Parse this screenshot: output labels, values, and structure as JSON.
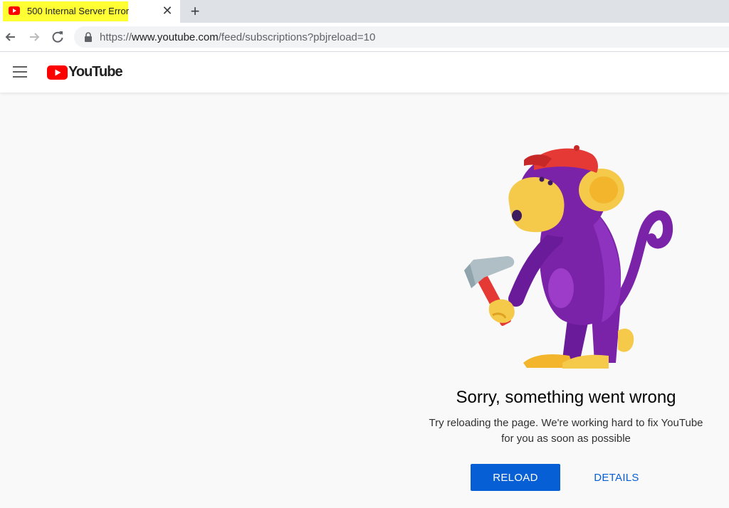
{
  "browser": {
    "tab": {
      "title": "500 Internal Server Error",
      "favicon": "youtube-icon",
      "highlight_color": "#ffff33"
    },
    "url": {
      "scheme": "https://",
      "host": "www.youtube.com",
      "path": "/feed/subscriptions?pbjreload=10"
    }
  },
  "masthead": {
    "logo_text": "YouTube",
    "brand_color": "#ff0000"
  },
  "error": {
    "title": "Sorry, something went wrong",
    "description_line1": "Try reloading the page. We're working hard to fix YouTube",
    "description_line2": "for you as soon as possible",
    "reload_label": "RELOAD",
    "details_label": "DETAILS",
    "accent_color": "#065fd4"
  }
}
